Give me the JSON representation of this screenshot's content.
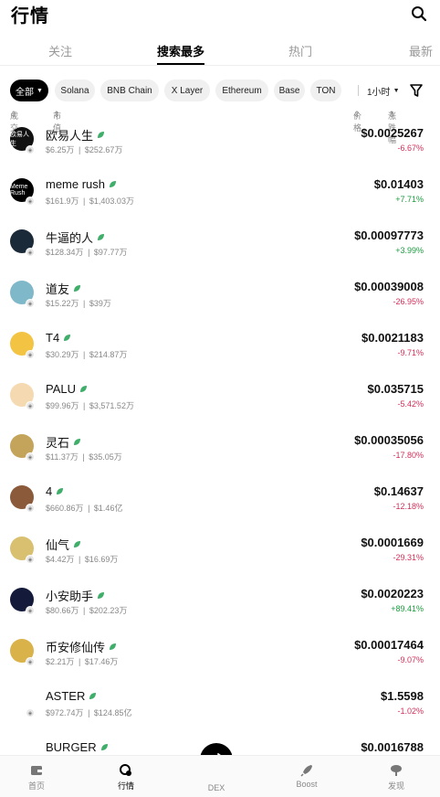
{
  "header": {
    "title": "行情"
  },
  "tabs": [
    {
      "label": "关注"
    },
    {
      "label": "搜索最多",
      "active": true
    },
    {
      "label": "热门"
    },
    {
      "label": "最新"
    }
  ],
  "filters": {
    "chips": [
      "全部",
      "Solana",
      "BNB Chain",
      "X Layer",
      "Ethereum",
      "Base",
      "TON"
    ],
    "time": "1小时"
  },
  "columns": {
    "volume": "成交额",
    "mcap": "市值",
    "price": "价格",
    "change": "涨跌幅"
  },
  "tokens": [
    {
      "name": "欧易人生",
      "volume": "$6.25万",
      "mcap": "$252.67万",
      "price": "$0.0025267",
      "change": "-6.67%",
      "dir": "neg",
      "avatar_color": "#111111",
      "avatar_text": "欧易人生"
    },
    {
      "name": "meme rush",
      "volume": "$161.9万",
      "mcap": "$1,403.03万",
      "price": "$0.01403",
      "change": "+7.71%",
      "dir": "pos",
      "avatar_color": "#000000",
      "avatar_text": "Meme Rush"
    },
    {
      "name": "牛逼的人",
      "volume": "$128.34万",
      "mcap": "$97.77万",
      "price": "$0.00097773",
      "change": "+3.99%",
      "dir": "pos",
      "avatar_color": "#1b2a38",
      "avatar_text": ""
    },
    {
      "name": "道友",
      "volume": "$15.22万",
      "mcap": "$39万",
      "price": "$0.00039008",
      "change": "-26.95%",
      "dir": "neg",
      "avatar_color": "#7fb8c9",
      "avatar_text": ""
    },
    {
      "name": "T4",
      "volume": "$30.29万",
      "mcap": "$214.87万",
      "price": "$0.0021183",
      "change": "-9.71%",
      "dir": "neg",
      "avatar_color": "#f3c443",
      "avatar_text": ""
    },
    {
      "name": "PALU",
      "volume": "$99.96万",
      "mcap": "$3,571.52万",
      "price": "$0.035715",
      "change": "-5.42%",
      "dir": "neg",
      "avatar_color": "#f5d9b0",
      "avatar_text": ""
    },
    {
      "name": "灵石",
      "volume": "$11.37万",
      "mcap": "$35.05万",
      "price": "$0.00035056",
      "change": "-17.80%",
      "dir": "neg",
      "avatar_color": "#c4a45a",
      "avatar_text": ""
    },
    {
      "name": "4",
      "volume": "$660.86万",
      "mcap": "$1.46亿",
      "price": "$0.14637",
      "change": "-12.18%",
      "dir": "neg",
      "avatar_color": "#8a5a3a",
      "avatar_text": ""
    },
    {
      "name": "仙气",
      "volume": "$4.42万",
      "mcap": "$16.69万",
      "price": "$0.0001669",
      "change": "-29.31%",
      "dir": "neg",
      "avatar_color": "#d8c070",
      "avatar_text": ""
    },
    {
      "name": "小安助手",
      "volume": "$80.66万",
      "mcap": "$202.23万",
      "price": "$0.0020223",
      "change": "+89.41%",
      "dir": "pos",
      "avatar_color": "#141a3a",
      "avatar_text": ""
    },
    {
      "name": "币安修仙传",
      "volume": "$2.21万",
      "mcap": "$17.46万",
      "price": "$0.00017464",
      "change": "-9.07%",
      "dir": "neg",
      "avatar_color": "#d9b24a",
      "avatar_text": ""
    },
    {
      "name": "ASTER",
      "volume": "$972.74万",
      "mcap": "$124.85亿",
      "price": "$1.5598",
      "change": "-1.02%",
      "dir": "neg",
      "avatar_color": "#ffffff",
      "avatar_text": ""
    },
    {
      "name": "BURGER",
      "volume": "",
      "mcap": "",
      "price": "$0.0016788",
      "change": "",
      "dir": "neg",
      "avatar_color": "#ffffff",
      "avatar_text": ""
    }
  ],
  "bottom_nav": [
    {
      "label": "首页",
      "icon": "wallet-icon"
    },
    {
      "label": "行情",
      "icon": "market-icon",
      "active": true
    },
    {
      "label": "DEX",
      "icon": "swap-icon"
    },
    {
      "label": "Boost",
      "icon": "rocket-icon"
    },
    {
      "label": "发现",
      "icon": "discover-icon"
    }
  ],
  "colors": {
    "negative": "#d42f5a",
    "positive": "#1a9c3e",
    "accent": "#000000"
  }
}
